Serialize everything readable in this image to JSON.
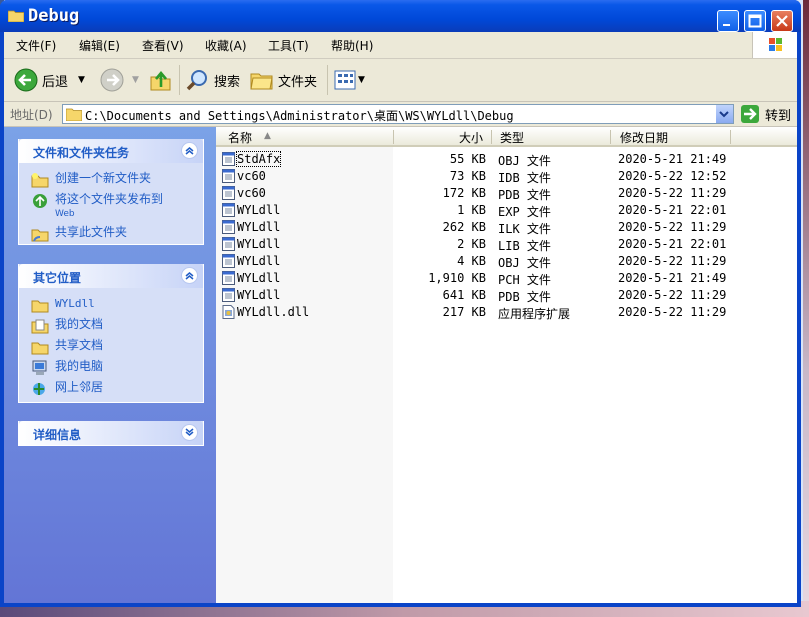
{
  "window": {
    "title": "Debug"
  },
  "menu": [
    {
      "label": "文件(F)"
    },
    {
      "label": "编辑(E)"
    },
    {
      "label": "查看(V)"
    },
    {
      "label": "收藏(A)"
    },
    {
      "label": "工具(T)"
    },
    {
      "label": "帮助(H)"
    }
  ],
  "toolbar": {
    "back_label": "后退",
    "search_label": "搜索",
    "folders_label": "文件夹"
  },
  "address": {
    "label": "地址(D)",
    "path": "C:\\Documents and Settings\\Administrator\\桌面\\WS\\WYLdll\\Debug",
    "go_label": "转到"
  },
  "tasks": {
    "file_tasks": {
      "title": "文件和文件夹任务",
      "items": [
        {
          "label": "创建一个新文件夹",
          "icon": "new-folder-icon"
        },
        {
          "label": "将这个文件夹发布到",
          "sub": "Web",
          "icon": "publish-web-icon"
        },
        {
          "label": "共享此文件夹",
          "icon": "share-folder-icon"
        }
      ]
    },
    "other_places": {
      "title": "其它位置",
      "items": [
        {
          "label": "WYLdll",
          "icon": "folder-icon"
        },
        {
          "label": "我的文档",
          "icon": "my-documents-icon"
        },
        {
          "label": "共享文档",
          "icon": "shared-documents-icon"
        },
        {
          "label": "我的电脑",
          "icon": "my-computer-icon"
        },
        {
          "label": "网上邻居",
          "icon": "network-places-icon"
        }
      ]
    },
    "details": {
      "title": "详细信息"
    }
  },
  "columns": {
    "name": "名称",
    "size": "大小",
    "type": "类型",
    "date": "修改日期"
  },
  "files": [
    {
      "name": "StdAfx",
      "size": "55 KB",
      "type": "OBJ 文件",
      "date": "2020-5-21 21:49"
    },
    {
      "name": "vc60",
      "size": "73 KB",
      "type": "IDB 文件",
      "date": "2020-5-22 12:52"
    },
    {
      "name": "vc60",
      "size": "172 KB",
      "type": "PDB 文件",
      "date": "2020-5-22 11:29"
    },
    {
      "name": "WYLdll",
      "size": "1 KB",
      "type": "EXP 文件",
      "date": "2020-5-21 22:01"
    },
    {
      "name": "WYLdll",
      "size": "262 KB",
      "type": "ILK 文件",
      "date": "2020-5-22 11:29"
    },
    {
      "name": "WYLdll",
      "size": "2 KB",
      "type": "LIB 文件",
      "date": "2020-5-21 22:01"
    },
    {
      "name": "WYLdll",
      "size": "4 KB",
      "type": "OBJ 文件",
      "date": "2020-5-22 11:29"
    },
    {
      "name": "WYLdll",
      "size": "1,910 KB",
      "type": "PCH 文件",
      "date": "2020-5-21 21:49"
    },
    {
      "name": "WYLdll",
      "size": "641 KB",
      "type": "PDB 文件",
      "date": "2020-5-22 11:29"
    },
    {
      "name": "WYLdll.dll",
      "size": "217 KB",
      "type": "应用程序扩展",
      "date": "2020-5-22 11:29"
    }
  ],
  "colors": {
    "title_blue": "#0a58e8",
    "task_link": "#215dc6",
    "pane_blue": "#7ba2e7",
    "close_red": "#c83818"
  }
}
